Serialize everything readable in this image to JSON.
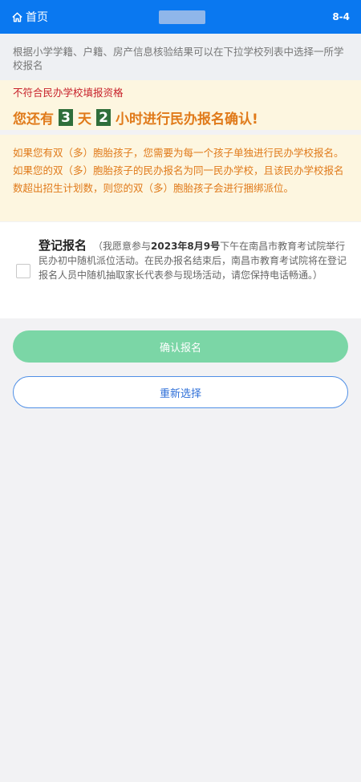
{
  "header": {
    "home_label": "首页",
    "page_code": "8-4"
  },
  "info": {
    "text": "根据小学学籍、户籍、房产信息核验结果可以在下拉学校列表中选择一所学校报名"
  },
  "warning": {
    "title": "不符合民办学校填报资格",
    "prefix": "您还有",
    "days": "3",
    "day_unit": "天",
    "hours": "2",
    "suffix": "小时进行民办报名确认!"
  },
  "notice": {
    "text": "如果您有双（多）胞胎孩子，您需要为每一个孩子单独进行民办学校报名。如果您的双（多）胞胎孩子的民办报名为同一民办学校，且该民办学校报名数超出招生计划数，则您的双（多）胞胎孩子会进行捆绑派位。"
  },
  "registration": {
    "title": "登记报名",
    "text_a": "（我愿意参与",
    "date_bold": "2023年8月9号",
    "text_b": "下午在南昌市教育考试院举行民办初中随机派位活动。在民办报名结束后，南昌市教育考试院将在登记报名人员中随机抽取家长代表参与现场活动，请您保持电话畅通。）"
  },
  "buttons": {
    "confirm": "确认报名",
    "reselect": "重新选择"
  }
}
